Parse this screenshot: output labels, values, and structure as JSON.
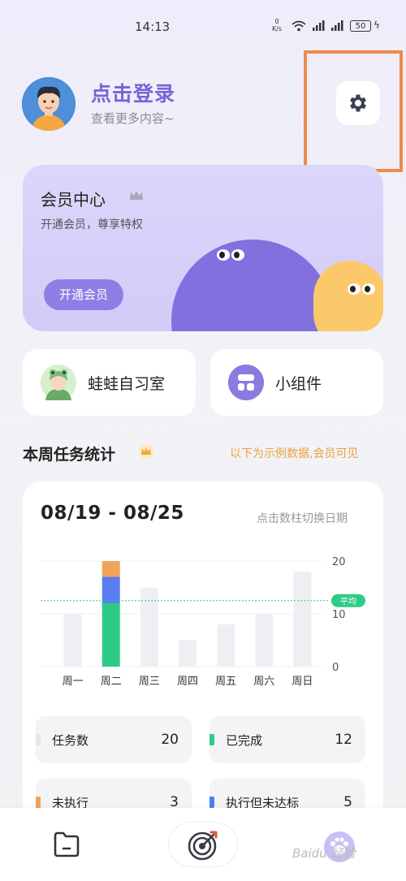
{
  "status_bar": {
    "time": "14:13",
    "net_speed_value": "0",
    "net_speed_unit": "K/s",
    "battery": "50"
  },
  "profile": {
    "title": "点击登录",
    "subtitle": "查看更多内容~"
  },
  "member": {
    "title": "会员中心",
    "subtitle": "开通会员，尊享特权",
    "button": "开通会员"
  },
  "shortcuts": [
    {
      "label": "蛙蛙自习室",
      "icon": "frog-avatar-icon"
    },
    {
      "label": "小组件",
      "icon": "widget-icon"
    }
  ],
  "weekly": {
    "title": "本周任务统计",
    "note": "以下为示例数据,会员可见",
    "date_range": "08/19 - 08/25",
    "hint": "点击数柱切换日期",
    "avg_label": "平均"
  },
  "chart_data": {
    "type": "bar",
    "categories": [
      "周一",
      "周二",
      "周三",
      "周四",
      "周五",
      "周六",
      "周日"
    ],
    "series": [
      {
        "name": "已完成",
        "values": [
          10,
          12,
          15,
          5,
          8,
          10,
          18
        ]
      },
      {
        "name": "执行但未达标",
        "values": [
          0,
          5,
          0,
          0,
          0,
          0,
          0
        ]
      },
      {
        "name": "未执行",
        "values": [
          0,
          3,
          0,
          0,
          0,
          0,
          0
        ]
      }
    ],
    "highlight_index": 1,
    "average": 12.5,
    "yticks": [
      "20",
      "10",
      "0"
    ],
    "ylim": [
      0,
      20
    ]
  },
  "stats": [
    {
      "label": "任务数",
      "value": "20",
      "color": "#e6e6ec"
    },
    {
      "label": "已完成",
      "value": "12",
      "color": "#2ecb87"
    },
    {
      "label": "未执行",
      "value": "3",
      "color": "#f0a15a"
    },
    {
      "label": "执行但未达标",
      "value": "5",
      "color": "#4a7ef0"
    }
  ],
  "colors": {
    "accent": "#7b62d6",
    "completed": "#2ecb87",
    "partial": "#5b7cf1",
    "missed": "#f0a45a",
    "bar_idle": "#efeff3",
    "average": "#2ecb87"
  },
  "watermark": "Baidu 经验"
}
